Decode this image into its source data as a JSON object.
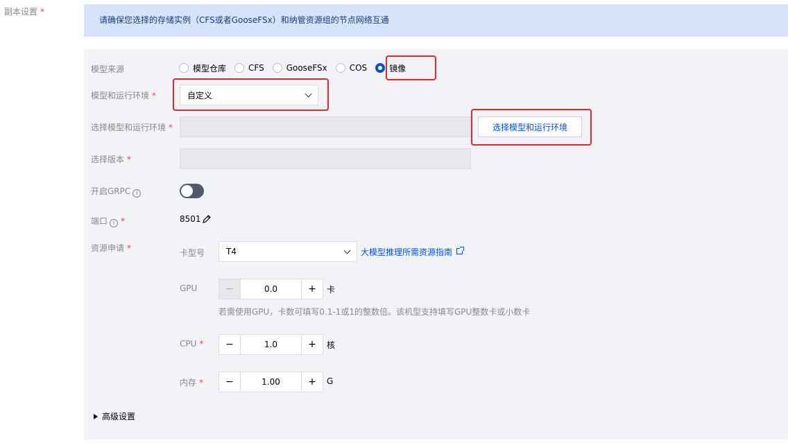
{
  "section": {
    "label": "副本设置",
    "required": "*"
  },
  "notice": {
    "text": "请确保您选择的存储实例（CFS或者GooseFSx）和纳管资源组的节点网络互通"
  },
  "model_source": {
    "label": "模型来源",
    "options": [
      {
        "label": "模型仓库",
        "checked": false
      },
      {
        "label": "CFS",
        "checked": false
      },
      {
        "label": "GooseFSx",
        "checked": false
      },
      {
        "label": "COS",
        "checked": false
      },
      {
        "label": "镜像",
        "checked": true
      }
    ]
  },
  "model_env": {
    "label": "模型和运行环境",
    "required": "*",
    "value": "自定义"
  },
  "select_model_env": {
    "label": "选择模型和运行环境",
    "required": "*",
    "button_label": "选择模型和运行环境"
  },
  "select_version": {
    "label": "选择版本",
    "required": "*"
  },
  "grpc": {
    "label": "开启GRPC",
    "enabled": false
  },
  "port": {
    "label": "端口",
    "required": "*",
    "value": "8501"
  },
  "resource": {
    "label": "资源申请",
    "required": "*",
    "card_type": {
      "label": "卡型号",
      "value": "T4",
      "guide_link": "大模型推理所需资源指南"
    },
    "gpu": {
      "label": "GPU",
      "value": "0.0",
      "unit": "卡",
      "hint": "若需使用GPU，卡数可填写0.1-1或1的整数倍。该机型支持填写GPU整数卡或小数卡"
    },
    "cpu": {
      "label": "CPU",
      "required": "*",
      "value": "1.0",
      "unit": "核"
    },
    "memory": {
      "label": "内存",
      "required": "*",
      "value": "1.00",
      "unit": "G"
    }
  },
  "advanced": {
    "label": "高级设置"
  },
  "glyphs": {
    "minus": "−",
    "plus": "+",
    "info": "i"
  },
  "colors": {
    "accent": "#0052d9",
    "highlight": "#e5262a",
    "required": "#e54545",
    "notice_bg": "#d5e4fb",
    "panel_bg": "#f2f3f7"
  }
}
